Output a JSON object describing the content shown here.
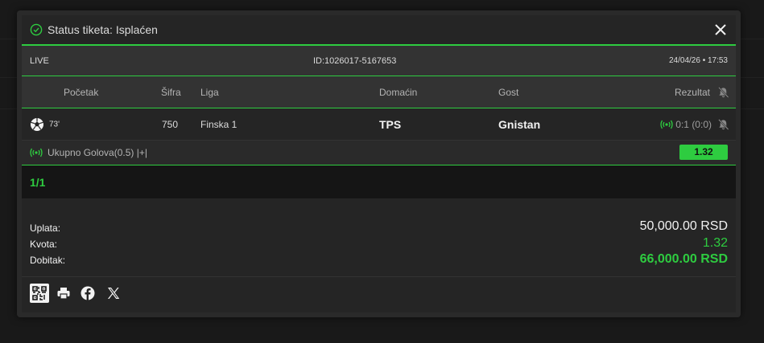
{
  "modal": {
    "title": "Status tiketa: Isplaćen",
    "mode": "LIVE",
    "ticket_id": "ID:1026017-5167653",
    "datetime": "24/04/26 • 17:53"
  },
  "columns": {
    "start": "Početak",
    "code": "Šifra",
    "league": "Liga",
    "home": "Domaćin",
    "away": "Gost",
    "result": "Rezultat"
  },
  "match": {
    "minute": "73'",
    "code": "750",
    "league": "Finska 1",
    "home": "TPS",
    "away": "Gnistan",
    "score": "0:1 (0:0)"
  },
  "pick": {
    "label": "Ukupno Golova(0.5) |+|",
    "odd": "1.32"
  },
  "count": "1/1",
  "summary": {
    "stake_label": "Uplata:",
    "stake_value": "50,000.00 RSD",
    "odds_label": "Kvota:",
    "odds_value": "1.32",
    "win_label": "Dobitak:",
    "win_value": "66,000.00 RSD"
  },
  "icons": {
    "status": "check-circle-icon",
    "close": "close-icon",
    "sport": "soccer-ball-icon",
    "live": "live-signal-icon",
    "bell": "bell-off-icon",
    "qr": "qr-code-icon",
    "print": "printer-icon",
    "facebook": "facebook-icon",
    "x": "x-twitter-icon"
  },
  "colors": {
    "accent": "#2ecc40",
    "background": "#191919",
    "panel": "#252525"
  }
}
